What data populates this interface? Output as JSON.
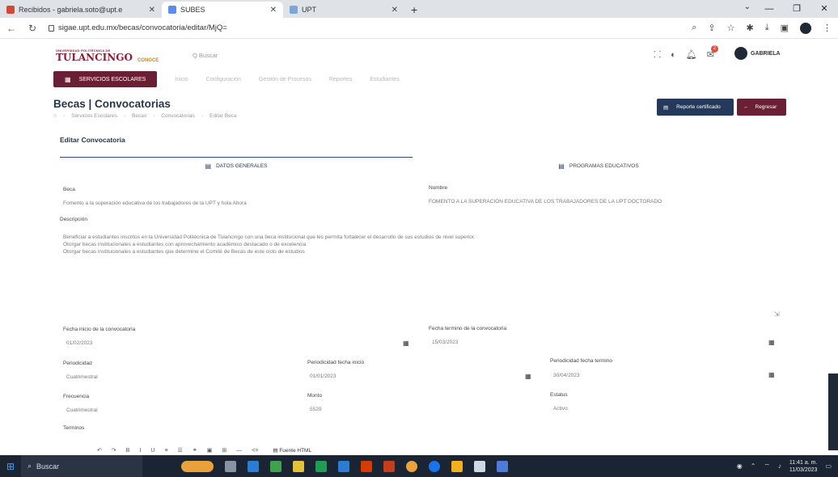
{
  "browser": {
    "tabs": [
      {
        "label": "Recibidos - gabriela.soto@upt.e",
        "active": false,
        "favicon_color": "#d44638"
      },
      {
        "label": "SUBES",
        "active": true,
        "favicon_color": "#5b8def"
      },
      {
        "label": "UPT",
        "active": false,
        "favicon_color": "#7aa7d6"
      }
    ],
    "url": "sigae.upt.edu.mx/becas/convocatoria/editar/MjQ="
  },
  "app": {
    "logo": {
      "small": "UNIVERSIDAD POLITÉCNICA DE",
      "big": "TULANCINGO",
      "tag": "CONOCE"
    },
    "search_placeholder": "Q Buscar",
    "notification_count": "2",
    "user_name": "GABRIELA",
    "menu": {
      "active": "SERVICIOS ESCOLARES",
      "items": [
        "Inicio",
        "Configuración",
        "Gestión de Procesos",
        "Reportes",
        "Estudiantes"
      ]
    }
  },
  "page": {
    "title": "Becas | Convocatorias",
    "breadcrumb": [
      "⌂",
      "Servicios Escolares",
      "Becas",
      "Convocatorias",
      "Editar Beca"
    ],
    "report_button": "Reporte certificado",
    "back_button": "Regresar",
    "card_title": "Editar Convocatoria",
    "tab_general": "DATOS GENERALES",
    "tab_docs": "PROGRAMAS EDUCATIVOS"
  },
  "form": {
    "beca_label": "Beca",
    "beca_value": "Fomento a la superación educativa de los trabajadores de la UPT y hola Ahora",
    "nombre_label": "Nombre",
    "nombre_value": "FOMENTO A LA SUPERACIÓN EDUCATIVA DE LOS TRABAJADORES DE LA UPT DOCTORADO",
    "descripcion_label": "Descripción",
    "descripcion_lines": [
      "Beneficiar a estudiantes inscritos en la Universidad Politécnica de Tulancingo con una beca institucional que les permita fortalecer el desarrollo de sus estudios de nivel superior.",
      "Otorgar becas institucionales a estudiantes con aprovechamiento académico destacado o de excelencia",
      "Otorgar becas institucionales a estudiantes que determine el Comité de Becas de este ciclo de estudios"
    ],
    "fecha_inicio_label": "Fecha inicio de la convocatoria",
    "fecha_inicio_value": "01/02/2023",
    "fecha_termino_label": "Fecha termino de la convocatoria",
    "fecha_termino_value": "15/03/2023",
    "periodicidad_label": "Periodicidad",
    "periodicidad_value": "Cuatrimestral",
    "periodicidad_inicio_label": "Periodicidad fecha inicio",
    "periodicidad_inicio_value": "01/01/2023",
    "periodicidad_termino_label": "Periodicidad fecha termino",
    "periodicidad_termino_value": "30/04/2023",
    "frecuencia_label": "Frecuencia",
    "frecuencia_value": "Cuatrimestral",
    "monto_label": "Monto",
    "monto_value": "5529",
    "estatus_label": "Estatus",
    "estatus_value": "Activo",
    "terminos_label": "Terminos",
    "editor_font": "Fuente HTML"
  },
  "taskbar": {
    "search": "Buscar",
    "time": "11:41 a. m.",
    "date": "11/03/2023",
    "apps_colors": [
      "#e9a23b",
      "#ffffff",
      "#2b7cd3",
      "#3fa34d",
      "#e3c33b",
      "#1f9d55",
      "#2b7cd3",
      "#d83b01",
      "#c43e1c",
      "#e8a33d",
      "#1a73e8",
      "#f2b01e",
      "#4caf50",
      "#ffffff"
    ]
  }
}
